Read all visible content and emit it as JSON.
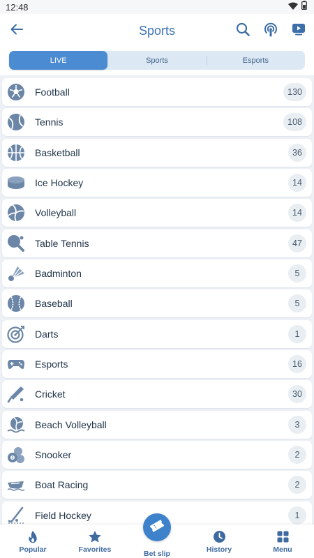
{
  "status_bar": {
    "time": "12:48"
  },
  "header": {
    "title": "Sports"
  },
  "tabs": [
    {
      "label": "LIVE",
      "active": true
    },
    {
      "label": "Sports",
      "active": false
    },
    {
      "label": "Esports",
      "active": false
    }
  ],
  "sports": [
    {
      "label": "Football",
      "count": "130",
      "icon": "football-icon"
    },
    {
      "label": "Tennis",
      "count": "108",
      "icon": "tennis-ball-icon"
    },
    {
      "label": "Basketball",
      "count": "36",
      "icon": "basketball-icon"
    },
    {
      "label": "Ice Hockey",
      "count": "14",
      "icon": "hockey-puck-icon"
    },
    {
      "label": "Volleyball",
      "count": "14",
      "icon": "volleyball-icon"
    },
    {
      "label": "Table Tennis",
      "count": "47",
      "icon": "ping-pong-paddle-icon"
    },
    {
      "label": "Badminton",
      "count": "5",
      "icon": "shuttlecock-icon"
    },
    {
      "label": "Baseball",
      "count": "5",
      "icon": "baseball-icon"
    },
    {
      "label": "Darts",
      "count": "1",
      "icon": "dartboard-icon"
    },
    {
      "label": "Esports",
      "count": "16",
      "icon": "gamepad-icon"
    },
    {
      "label": "Cricket",
      "count": "30",
      "icon": "cricket-bat-icon"
    },
    {
      "label": "Beach Volleyball",
      "count": "3",
      "icon": "beach-volleyball-icon"
    },
    {
      "label": "Snooker",
      "count": "2",
      "icon": "snooker-balls-icon"
    },
    {
      "label": "Boat Racing",
      "count": "2",
      "icon": "boat-icon"
    },
    {
      "label": "Field Hockey",
      "count": "1",
      "icon": "field-hockey-stick-icon"
    }
  ],
  "bottom_nav": [
    {
      "label": "Popular",
      "icon": "flame-icon"
    },
    {
      "label": "Favorites",
      "icon": "star-icon"
    },
    {
      "label": "Bet slip",
      "icon": "ticket-icon"
    },
    {
      "label": "History",
      "icon": "clock-icon"
    },
    {
      "label": "Menu",
      "icon": "grid-icon"
    }
  ],
  "colors": {
    "accent": "#4a8bd1",
    "title": "#3d74b6",
    "icon": "#6b86a6",
    "background": "#edf1f6"
  }
}
